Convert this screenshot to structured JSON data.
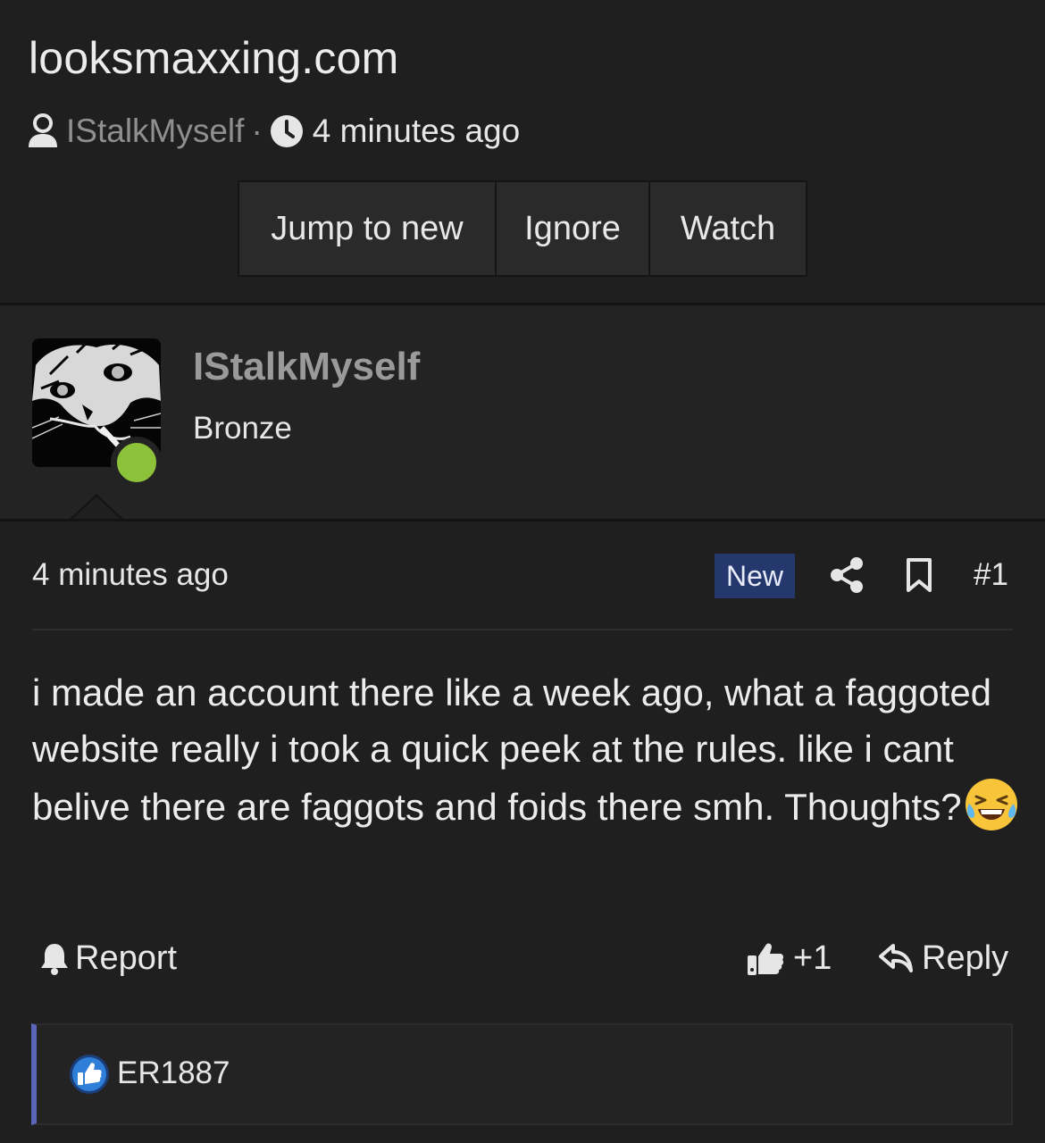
{
  "thread": {
    "title": "looksmaxxing.com",
    "author": "IStalkMyself",
    "separator": "·",
    "time": "4 minutes ago",
    "buttons": {
      "jump_to_new": "Jump to new",
      "ignore": "Ignore",
      "watch": "Watch"
    }
  },
  "post": {
    "username": "IStalkMyself",
    "rank": "Bronze",
    "online": true,
    "time": "4 minutes ago",
    "badge": "New",
    "number": "#1",
    "body": "i made an account there like a week ago, what a faggoted website really i took a quick peek at the rules. like i cant belive there are faggots and foids there smh. Thoughts?",
    "emoji": "laughing-tears-emoji",
    "actions": {
      "report": "Report",
      "like_count": "+1",
      "reply": "Reply"
    }
  },
  "reactions": {
    "type": "like",
    "users": [
      "ER1887"
    ]
  },
  "colors": {
    "background": "#1f1f1f",
    "panel": "#232323",
    "new_badge": "#25386e",
    "online": "#8cc23a",
    "reaction_border": "#5b66b8",
    "like_blue": "#2f7fd9"
  },
  "icons": {
    "user": "user-icon",
    "clock": "clock-icon",
    "share": "share-icon",
    "bookmark": "bookmark-icon",
    "bell": "bell-icon",
    "thumbs_up": "thumbs-up-icon",
    "reply": "reply-arrow-icon"
  }
}
